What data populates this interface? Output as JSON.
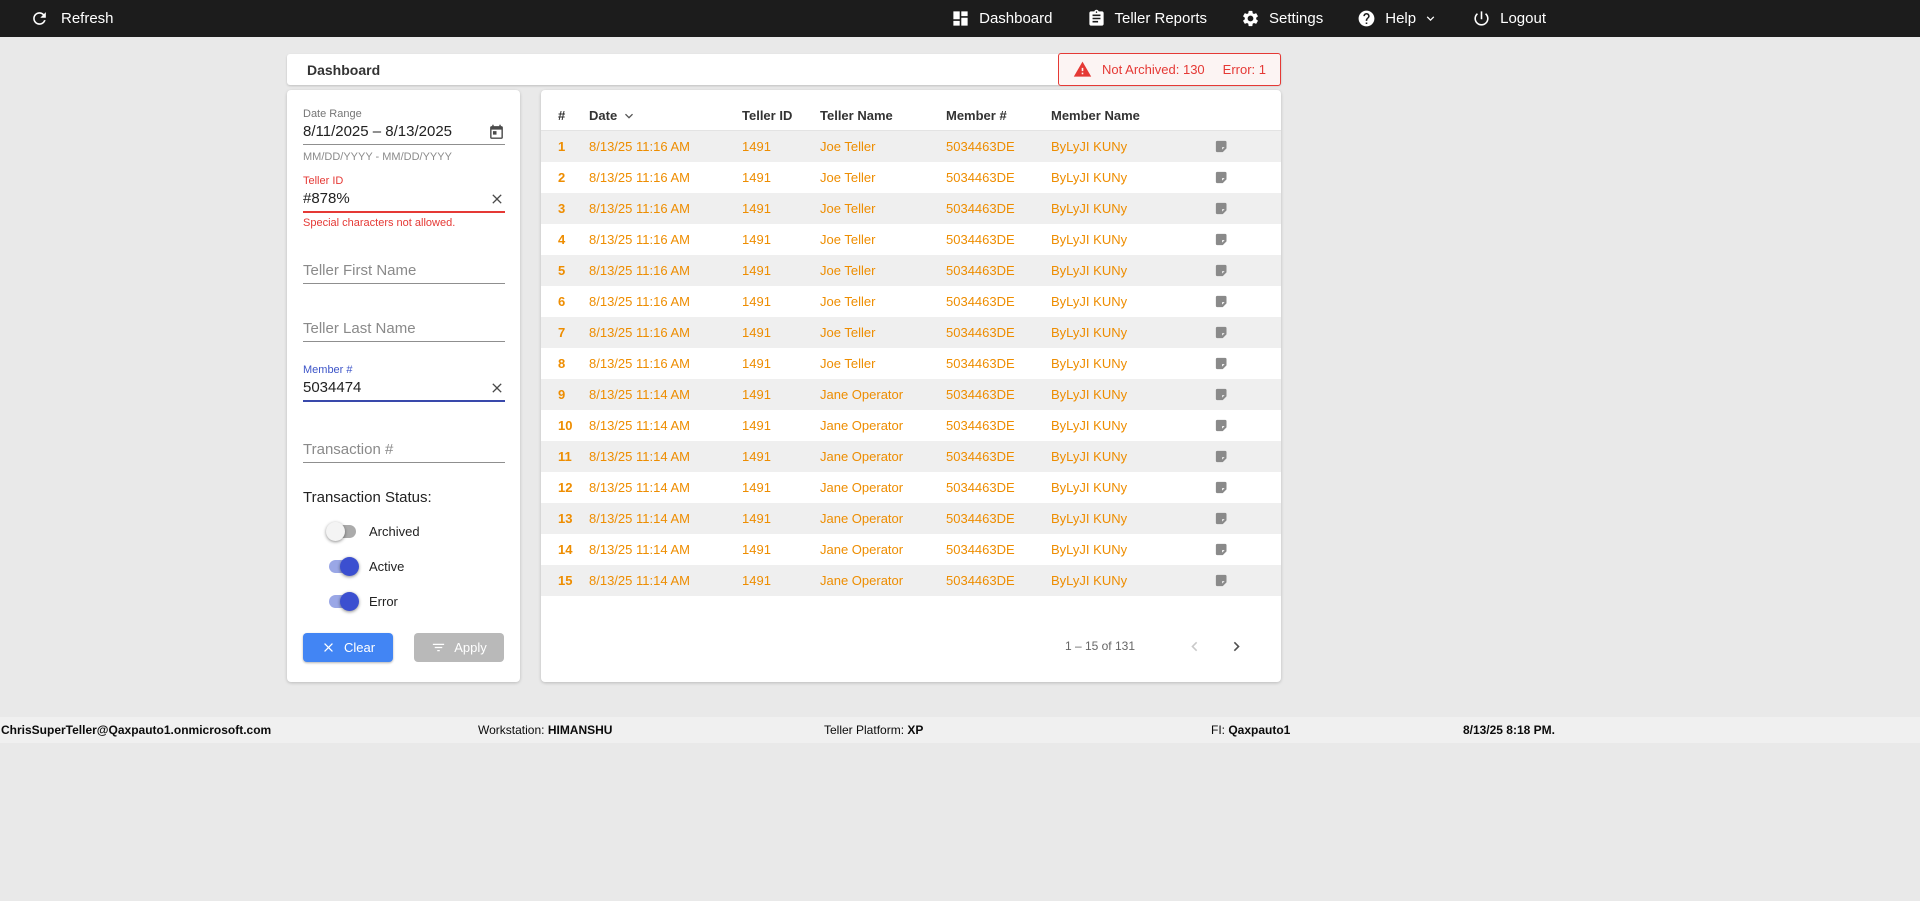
{
  "topbar": {
    "refresh_label": "Refresh",
    "nav": [
      {
        "label": "Dashboard"
      },
      {
        "label": "Teller Reports"
      },
      {
        "label": "Settings"
      },
      {
        "label": "Help"
      },
      {
        "label": "Logout"
      }
    ]
  },
  "header": {
    "title": "Dashboard",
    "alert": {
      "not_archived": "Not Archived: 130",
      "error": "Error: 1"
    }
  },
  "filters": {
    "date_range": {
      "label": "Date Range",
      "value": "8/11/2025 – 8/13/2025",
      "helper": "MM/DD/YYYY - MM/DD/YYYY"
    },
    "teller_id": {
      "label": "Teller ID",
      "value": "#878%",
      "error": "Special characters not allowed."
    },
    "teller_first_name": {
      "placeholder": "Teller First Name"
    },
    "teller_last_name": {
      "placeholder": "Teller Last Name"
    },
    "member_number": {
      "label": "Member #",
      "value": "5034474"
    },
    "transaction_number": {
      "placeholder": "Transaction #"
    },
    "transaction_status": {
      "label": "Transaction Status:",
      "toggles": [
        {
          "label": "Archived",
          "on": false
        },
        {
          "label": "Active",
          "on": true
        },
        {
          "label": "Error",
          "on": true
        }
      ]
    },
    "clear_label": "Clear",
    "apply_label": "Apply"
  },
  "table": {
    "columns": [
      "#",
      "Date",
      "Teller ID",
      "Teller Name",
      "Member #",
      "Member Name"
    ],
    "rows": [
      {
        "num": "1",
        "date": "8/13/25 11:16 AM",
        "teller_id": "1491",
        "teller_name": "Joe Teller",
        "member_num": "5034463DE",
        "member_name": "ByLyJI KUNy"
      },
      {
        "num": "2",
        "date": "8/13/25 11:16 AM",
        "teller_id": "1491",
        "teller_name": "Joe Teller",
        "member_num": "5034463DE",
        "member_name": "ByLyJI KUNy"
      },
      {
        "num": "3",
        "date": "8/13/25 11:16 AM",
        "teller_id": "1491",
        "teller_name": "Joe Teller",
        "member_num": "5034463DE",
        "member_name": "ByLyJI KUNy"
      },
      {
        "num": "4",
        "date": "8/13/25 11:16 AM",
        "teller_id": "1491",
        "teller_name": "Joe Teller",
        "member_num": "5034463DE",
        "member_name": "ByLyJI KUNy"
      },
      {
        "num": "5",
        "date": "8/13/25 11:16 AM",
        "teller_id": "1491",
        "teller_name": "Joe Teller",
        "member_num": "5034463DE",
        "member_name": "ByLyJI KUNy"
      },
      {
        "num": "6",
        "date": "8/13/25 11:16 AM",
        "teller_id": "1491",
        "teller_name": "Joe Teller",
        "member_num": "5034463DE",
        "member_name": "ByLyJI KUNy"
      },
      {
        "num": "7",
        "date": "8/13/25 11:16 AM",
        "teller_id": "1491",
        "teller_name": "Joe Teller",
        "member_num": "5034463DE",
        "member_name": "ByLyJI KUNy"
      },
      {
        "num": "8",
        "date": "8/13/25 11:16 AM",
        "teller_id": "1491",
        "teller_name": "Joe Teller",
        "member_num": "5034463DE",
        "member_name": "ByLyJI KUNy"
      },
      {
        "num": "9",
        "date": "8/13/25 11:14 AM",
        "teller_id": "1491",
        "teller_name": "Jane Operator",
        "member_num": "5034463DE",
        "member_name": "ByLyJI KUNy"
      },
      {
        "num": "10",
        "date": "8/13/25 11:14 AM",
        "teller_id": "1491",
        "teller_name": "Jane Operator",
        "member_num": "5034463DE",
        "member_name": "ByLyJI KUNy"
      },
      {
        "num": "11",
        "date": "8/13/25 11:14 AM",
        "teller_id": "1491",
        "teller_name": "Jane Operator",
        "member_num": "5034463DE",
        "member_name": "ByLyJI KUNy"
      },
      {
        "num": "12",
        "date": "8/13/25 11:14 AM",
        "teller_id": "1491",
        "teller_name": "Jane Operator",
        "member_num": "5034463DE",
        "member_name": "ByLyJI KUNy"
      },
      {
        "num": "13",
        "date": "8/13/25 11:14 AM",
        "teller_id": "1491",
        "teller_name": "Jane Operator",
        "member_num": "5034463DE",
        "member_name": "ByLyJI KUNy"
      },
      {
        "num": "14",
        "date": "8/13/25 11:14 AM",
        "teller_id": "1491",
        "teller_name": "Jane Operator",
        "member_num": "5034463DE",
        "member_name": "ByLyJI KUNy"
      },
      {
        "num": "15",
        "date": "8/13/25 11:14 AM",
        "teller_id": "1491",
        "teller_name": "Jane Operator",
        "member_num": "5034463DE",
        "member_name": "ByLyJI KUNy"
      }
    ],
    "pagination": {
      "range": "1 – 15 of 131"
    }
  },
  "footer": {
    "email": "ChrisSuperTeller@Qaxpauto1.onmicrosoft.com",
    "workstation_label": "Workstation: ",
    "workstation_value": "HIMANSHU",
    "platform_label": "Teller Platform: ",
    "platform_value": "XP",
    "fi_label": "FI: ",
    "fi_value": "Qaxpauto1",
    "datetime": "8/13/25 8:18 PM."
  },
  "colors": {
    "accent_blue": "#4285f4",
    "toggle_on_blue": "#3b4fd0",
    "error_red": "#e53935",
    "row_orange": "#ee8d00",
    "topbar_bg": "#1c1c1c"
  }
}
